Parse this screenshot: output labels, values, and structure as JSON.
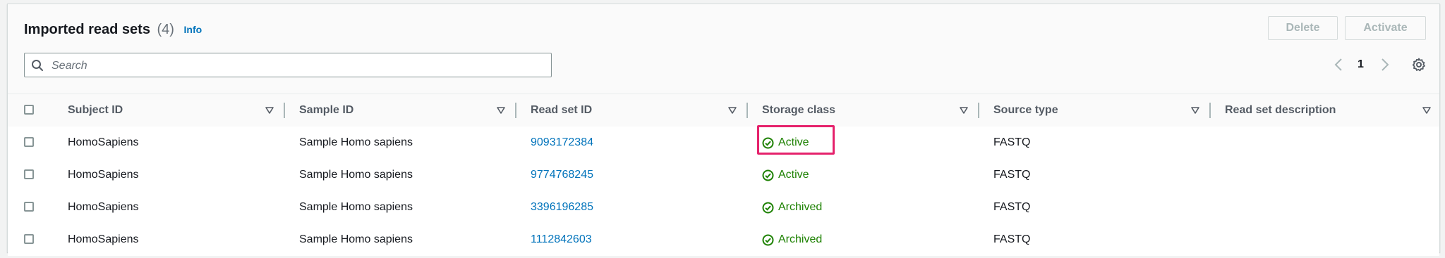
{
  "header": {
    "title": "Imported read sets",
    "count": "(4)",
    "info_label": "Info"
  },
  "actions": {
    "delete_label": "Delete",
    "activate_label": "Activate"
  },
  "search": {
    "placeholder": "Search",
    "value": ""
  },
  "pagination": {
    "current_page": "1"
  },
  "table": {
    "columns": [
      "Subject ID",
      "Sample ID",
      "Read set ID",
      "Storage class",
      "Source type",
      "Read set description"
    ],
    "rows": [
      {
        "subject_id": "HomoSapiens",
        "sample_id": "Sample Homo sapiens",
        "read_set_id": "9093172384",
        "storage_class": "Active",
        "source_type": "FASTQ",
        "description": ""
      },
      {
        "subject_id": "HomoSapiens",
        "sample_id": "Sample Homo sapiens",
        "read_set_id": "9774768245",
        "storage_class": "Active",
        "source_type": "FASTQ",
        "description": ""
      },
      {
        "subject_id": "HomoSapiens",
        "sample_id": "Sample Homo sapiens",
        "read_set_id": "3396196285",
        "storage_class": "Archived",
        "source_type": "FASTQ",
        "description": ""
      },
      {
        "subject_id": "HomoSapiens",
        "sample_id": "Sample Homo sapiens",
        "read_set_id": "1112842603",
        "storage_class": "Archived",
        "source_type": "FASTQ",
        "description": ""
      }
    ]
  },
  "icons": {
    "search": "search-icon",
    "prev": "chevron-left-icon",
    "next": "chevron-right-icon",
    "settings": "gear-icon",
    "sort": "caret-down-icon",
    "status": "check-circle-icon"
  },
  "colors": {
    "link": "#0073bb",
    "status_success": "#1d8102",
    "highlight": "#e5216b"
  }
}
